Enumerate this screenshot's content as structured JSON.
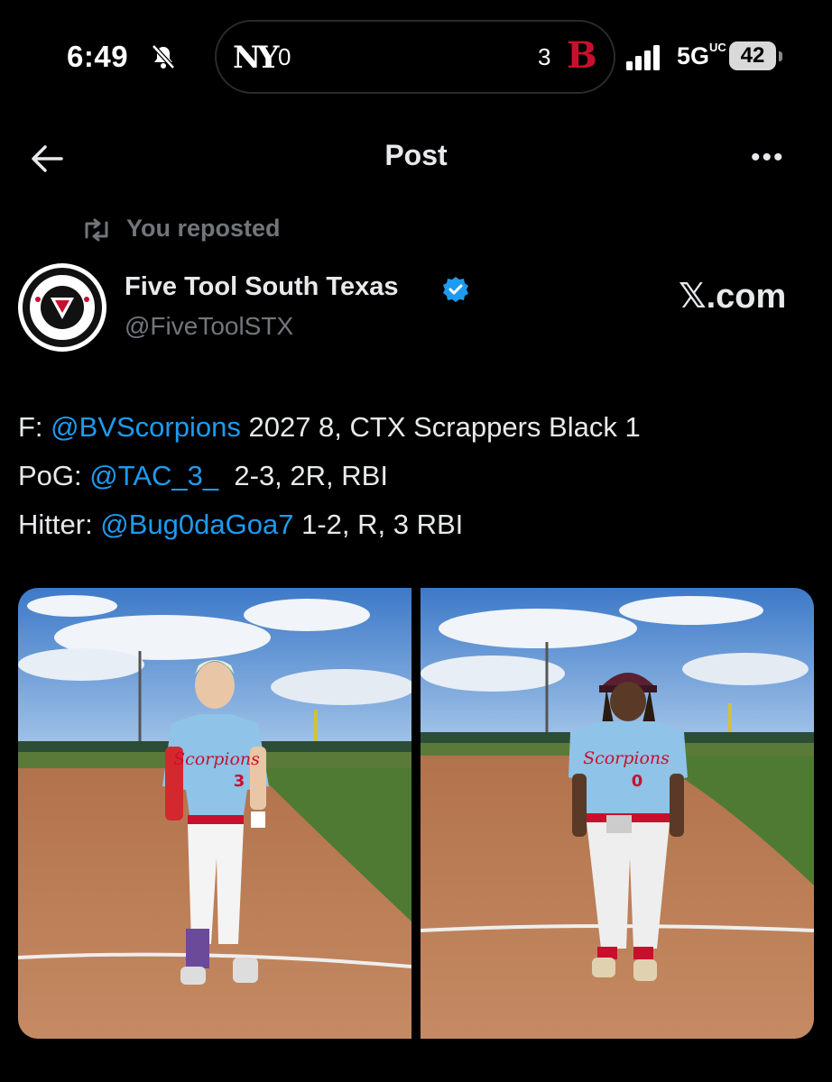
{
  "status_bar": {
    "time": "6:49",
    "live_activity": {
      "away_team_icon": "yankees-logo",
      "away_logo_text": "NY",
      "away_score": "0",
      "home_score": "3",
      "home_team_icon": "red-sox-logo",
      "home_logo_text": "B"
    },
    "network": "5G",
    "network_suffix": "UC",
    "battery": "42",
    "icons": [
      "bell-slash-icon",
      "cellular-signal-icon",
      "battery-icon"
    ]
  },
  "header": {
    "title": "Post",
    "back_icon": "arrow-left-icon",
    "more_icon": "more-horizontal-icon",
    "more_label": "•••"
  },
  "repost": {
    "label": "You reposted",
    "icon": "repost-icon"
  },
  "author": {
    "name": "Five Tool South Texas",
    "handle": "@FiveToolSTX",
    "verified": true,
    "avatar_icon": "five-tool-logo",
    "source_label": "𝕏.com"
  },
  "tweet": {
    "lines": [
      {
        "prefix": "F: ",
        "mention": "@BVScorpions",
        "suffix": " 2027 8, CTX Scrappers Black 1"
      },
      {
        "prefix": "PoG: ",
        "mention": "@TAC_3_",
        "suffix": "  2-3, 2R, RBI"
      },
      {
        "prefix": "Hitter: ",
        "mention": "@Bug0daGoa7",
        "suffix": " 1-2, R, 3 RBI"
      }
    ]
  },
  "media": [
    {
      "jersey_number": "3",
      "jersey_text": "Scorpions"
    },
    {
      "jersey_number": "0",
      "jersey_text": "Scorpions"
    }
  ],
  "colors": {
    "background": "#000000",
    "text": "#e7e9ea",
    "secondary": "#71767b",
    "link": "#1d9bf0",
    "jersey": "#8fc3e8",
    "jersey_red": "#c8102e"
  }
}
